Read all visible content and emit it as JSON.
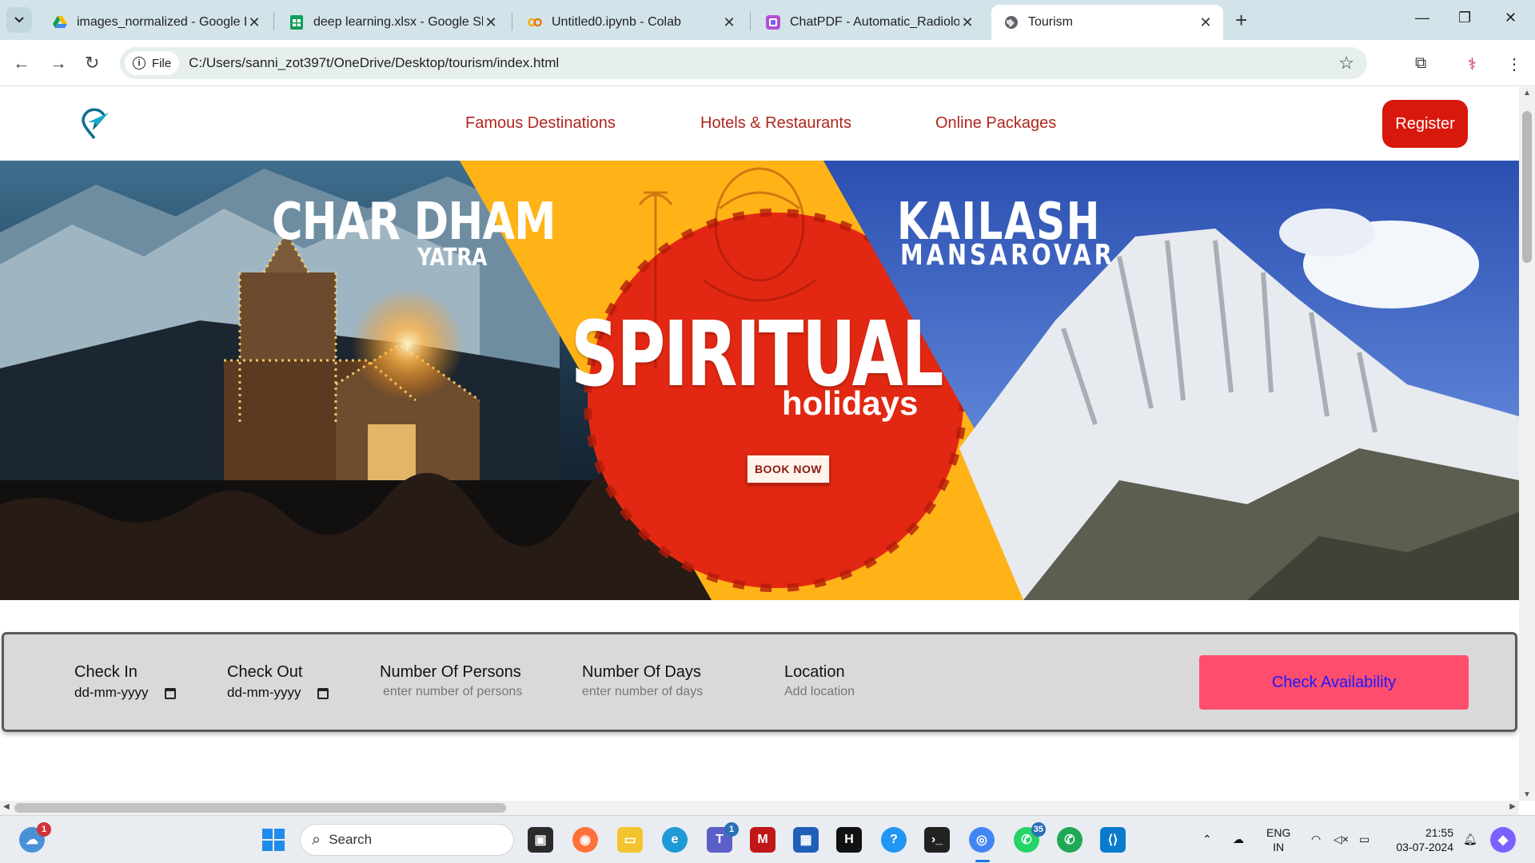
{
  "browser": {
    "tabs": [
      {
        "title": "images_normalized - Google Dr",
        "icon": "google-drive-icon"
      },
      {
        "title": "deep learning.xlsx - Google She",
        "icon": "google-sheets-icon"
      },
      {
        "title": "Untitled0.ipynb - Colab",
        "icon": "colab-icon"
      },
      {
        "title": "ChatPDF - Automatic_Radiology",
        "icon": "chatpdf-icon"
      },
      {
        "title": "Tourism",
        "icon": "globe-icon",
        "active": true
      }
    ],
    "security_chip": "File",
    "url": "C:/Users/sanni_zot397t/OneDrive/Desktop/tourism/index.html"
  },
  "site": {
    "nav": {
      "links": [
        "Famous Destinations",
        "Hotels & Restaurants",
        "Online Packages"
      ],
      "register_label": "Register"
    },
    "hero": {
      "left_title": "CHAR DHAM",
      "left_subtitle": "YATRA",
      "center_title": "SPIRITUAL",
      "center_subtitle": "holidays",
      "book_label": "BOOK NOW",
      "right_title": "KAILASH",
      "right_subtitle": "MANSAROVAR"
    },
    "booking": {
      "check_in_label": "Check In",
      "check_in_value": "dd-mm-yyyy",
      "check_out_label": "Check Out",
      "check_out_value": "dd-mm-yyyy",
      "persons_label": "Number Of Persons",
      "persons_placeholder": "enter number of persons",
      "days_label": "Number Of Days",
      "days_placeholder": "enter number of days",
      "location_label": "Location",
      "location_placeholder": "Add location",
      "submit_label": "Check Availability"
    }
  },
  "taskbar": {
    "weather_badge": "1",
    "search_placeholder": "Search",
    "teams_badge": "1",
    "whatsapp_badge": "35",
    "lang_top": "ENG",
    "lang_bottom": "IN",
    "time": "21:55",
    "date": "03-07-2024"
  },
  "colors": {
    "nav_link": "#b0261e",
    "register_bg": "#d8180c",
    "check_btn_bg": "#ff4d6d",
    "check_btn_text": "#1a1aff"
  }
}
